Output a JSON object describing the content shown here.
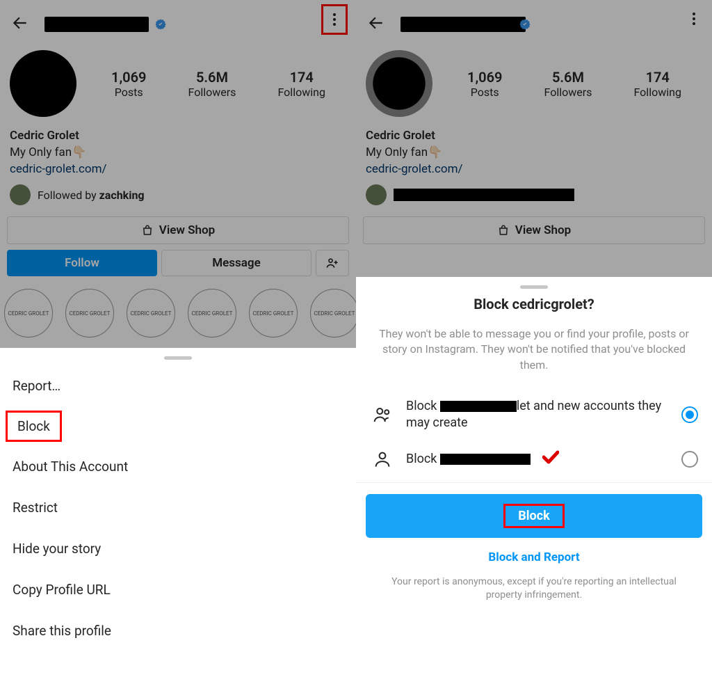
{
  "left": {
    "username_redacted_width": 150,
    "stats": {
      "posts": {
        "value": "1,069",
        "label": "Posts"
      },
      "followers": {
        "value": "5.6M",
        "label": "Followers"
      },
      "following": {
        "value": "174",
        "label": "Following"
      }
    },
    "bio": {
      "name": "Cedric Grolet",
      "tagline": "My Only fan👇🏻",
      "link": "cedric-grolet.com/"
    },
    "followed_by_prefix": "Followed by ",
    "followed_by_name": "zachking",
    "view_shop": "View Shop",
    "follow": "Follow",
    "message": "Message",
    "highlight_label": "CEDRIC GROLET",
    "menu": {
      "report": "Report…",
      "block": "Block",
      "about": "About This Account",
      "restrict": "Restrict",
      "hide": "Hide your story",
      "copy": "Copy Profile URL",
      "share": "Share this profile"
    }
  },
  "right": {
    "username_redacted_width": 180,
    "stats": {
      "posts": {
        "value": "1,069",
        "label": "Posts"
      },
      "followers": {
        "value": "5.6M",
        "label": "Followers"
      },
      "following": {
        "value": "174",
        "label": "Following"
      }
    },
    "bio": {
      "name": "Cedric Grolet",
      "tagline": "My Only fan👇🏻",
      "link": "cedric-grolet.com/"
    },
    "view_shop": "View Shop",
    "block": {
      "title": "Block cedricgrolet?",
      "desc": "They won't be able to message you or find your profile, posts or story on Instagram. They won't be notified that you've blocked them.",
      "opt1_prefix": "Block ",
      "opt1_suffix": "let and new accounts they may create",
      "opt2_prefix": "Block ",
      "primary": "Block",
      "link": "Block and Report",
      "footnote": "Your report is anonymous, except if you're reporting an intellectual property infringement."
    }
  }
}
